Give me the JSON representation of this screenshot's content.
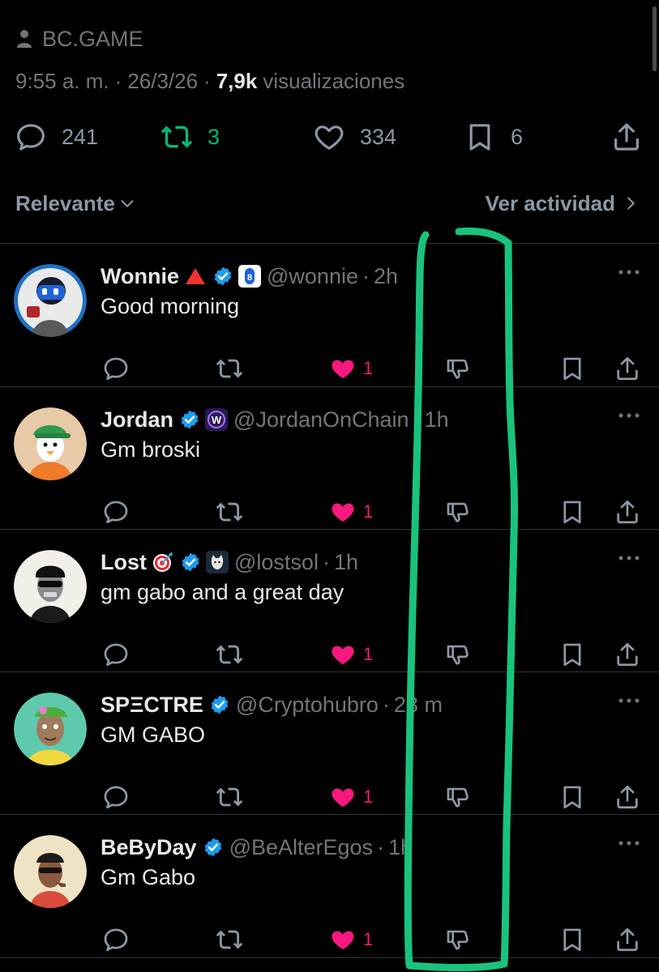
{
  "post": {
    "source_label": "BC.GAME",
    "time": "9:55 a. m.",
    "date": "26/3/26",
    "separator": "·",
    "views_count": "7,9k",
    "views_label": "visualizaciones",
    "stats": {
      "replies": "241",
      "reposts": "3",
      "likes": "334",
      "bookmarks": "6"
    }
  },
  "sort": {
    "label": "Relevante",
    "activity_label": "Ver actividad"
  },
  "colors": {
    "background": "#000000",
    "accent_green": "#00ba7c",
    "like_pink": "#f91880",
    "verified_blue": "#1d9bf0",
    "annotation_green": "#19c37d"
  },
  "replies": [
    {
      "name": "Wonnie",
      "handle": "@wonnie",
      "time": "2h",
      "text": "Good morning",
      "likes": "1",
      "emoji": "red-triangle-icon",
      "affiliation": "bcgame-badge-icon"
    },
    {
      "name": "Jordan",
      "handle": "@JordanOnChain",
      "time": "1h",
      "text": "Gm broski",
      "likes": "1",
      "emoji": "",
      "affiliation": "w-badge-icon"
    },
    {
      "name": "Lost",
      "handle": "@lostsol",
      "time": "1h",
      "text": "gm gabo and a great day",
      "likes": "1",
      "emoji": "target-icon",
      "affiliation": "cat-badge-icon"
    },
    {
      "name": "SPΞCTRE",
      "handle": "@Cryptohubro",
      "time": "28 m",
      "text": "GM GABO",
      "likes": "1",
      "emoji": "",
      "affiliation": ""
    },
    {
      "name": "BeByDay",
      "handle": "@BeAlterEgos",
      "time": "1h",
      "text": "Gm Gabo",
      "likes": "1",
      "emoji": "",
      "affiliation": ""
    }
  ]
}
